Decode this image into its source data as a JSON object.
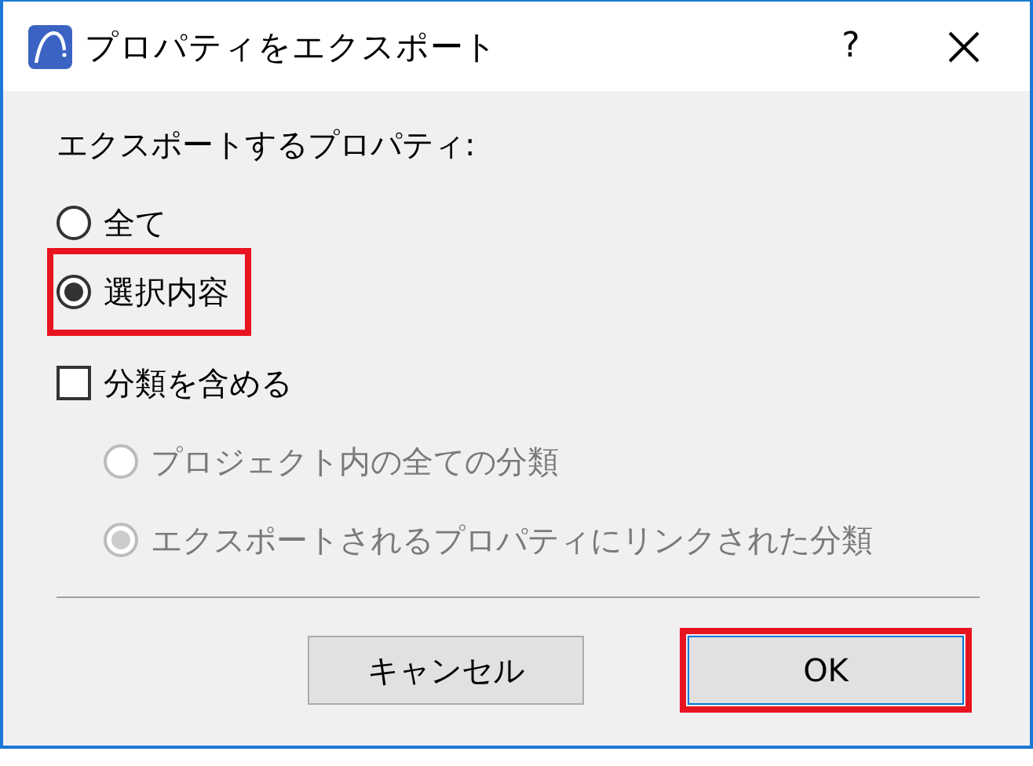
{
  "window": {
    "title": "プロパティをエクスポート",
    "help": "?"
  },
  "group_label": "エクスポートするプロパティ:",
  "scope_options": [
    {
      "label": "全て",
      "selected": false,
      "highlighted": false
    },
    {
      "label": "選択内容",
      "selected": true,
      "highlighted": true
    }
  ],
  "include_classification": {
    "label": "分類を含める",
    "checked": false
  },
  "classification_options": [
    {
      "label": "プロジェクト内の全ての分類",
      "selected": false,
      "disabled": true
    },
    {
      "label": "エクスポートされるプロパティにリンクされた分類",
      "selected": true,
      "disabled": true
    }
  ],
  "buttons": [
    {
      "label": "キャンセル",
      "highlighted": false
    },
    {
      "label": "OK",
      "highlighted": true
    }
  ]
}
